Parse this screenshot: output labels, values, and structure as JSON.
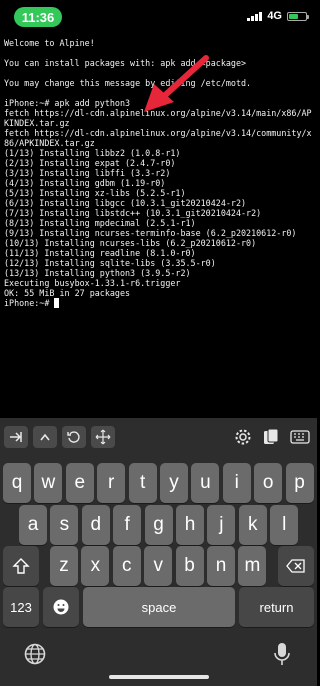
{
  "status": {
    "time": "11:36",
    "network": "4G"
  },
  "terminal": {
    "lines": [
      "Welcome to Alpine!",
      "",
      "You can install packages with: apk add <package>",
      "",
      "You may change this message by editing /etc/motd.",
      "",
      "iPhone:~# apk add python3",
      "fetch https://dl-cdn.alpinelinux.org/alpine/v3.14/main/x86/APKINDEX.tar.gz",
      "fetch https://dl-cdn.alpinelinux.org/alpine/v3.14/community/x86/APKINDEX.tar.gz",
      "(1/13) Installing libbz2 (1.0.8-r1)",
      "(2/13) Installing expat (2.4.7-r0)",
      "(3/13) Installing libffi (3.3-r2)",
      "(4/13) Installing gdbm (1.19-r0)",
      "(5/13) Installing xz-libs (5.2.5-r1)",
      "(6/13) Installing libgcc (10.3.1_git20210424-r2)",
      "(7/13) Installing libstdc++ (10.3.1_git20210424-r2)",
      "(8/13) Installing mpdecimal (2.5.1-r1)",
      "(9/13) Installing ncurses-terminfo-base (6.2_p20210612-r0)",
      "(10/13) Installing ncurses-libs (6.2_p20210612-r0)",
      "(11/13) Installing readline (8.1.0-r0)",
      "(12/13) Installing sqlite-libs (3.35.5-r0)",
      "(13/13) Installing python3 (3.9.5-r2)",
      "Executing busybox-1.33.1-r6.trigger",
      "OK: 55 MiB in 27 packages"
    ],
    "prompt": "iPhone:~# "
  },
  "keyboard": {
    "row1": [
      "q",
      "w",
      "e",
      "r",
      "t",
      "y",
      "u",
      "i",
      "o",
      "p"
    ],
    "row2": [
      "a",
      "s",
      "d",
      "f",
      "g",
      "h",
      "j",
      "k",
      "l"
    ],
    "row3": [
      "z",
      "x",
      "c",
      "v",
      "b",
      "n",
      "m"
    ],
    "numbers_label": "123",
    "space_label": "space",
    "return_label": "return"
  }
}
